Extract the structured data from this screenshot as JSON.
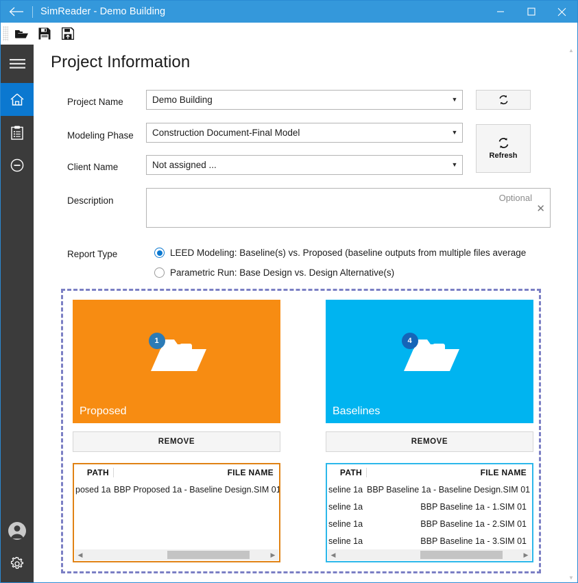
{
  "window": {
    "title": "SimReader - Demo Building",
    "back_icon": "back-arrow-icon",
    "minimize": "—",
    "maximize": "□",
    "close": "✕"
  },
  "toolbar": {
    "items": [
      {
        "name": "open-file-icon",
        "tooltip": "Open"
      },
      {
        "name": "save-icon",
        "tooltip": "Save"
      },
      {
        "name": "save-as-icon",
        "tooltip": "Save As"
      }
    ]
  },
  "sidebar": {
    "menu_icon": "hamburger-menu-icon",
    "items": [
      {
        "name": "home-icon",
        "active": true
      },
      {
        "name": "clipboard-icon",
        "active": false
      },
      {
        "name": "minus-circle-icon",
        "active": false
      }
    ],
    "bottom_items": [
      {
        "name": "user-account-icon"
      },
      {
        "name": "settings-gear-icon"
      }
    ],
    "active_color": "#0b78d0",
    "background": "#3b3b3b"
  },
  "main": {
    "page_title": "Project Information",
    "fields": {
      "project_name": {
        "label": "Project Name",
        "value": "Demo Building"
      },
      "modeling_phase": {
        "label": "Modeling Phase",
        "value": "Construction Document-Final Model"
      },
      "client_name": {
        "label": "Client Name",
        "value": "Not assigned ..."
      },
      "description": {
        "label": "Description",
        "value": "",
        "placeholder": "Optional",
        "clear_icon": "clear-x-icon"
      }
    },
    "refresh_small": {
      "icon": "refresh-icon"
    },
    "refresh_large": {
      "icon": "refresh-icon",
      "label": "Refresh"
    },
    "report_type": {
      "label": "Report Type",
      "options": [
        {
          "label": "LEED Modeling: Baseline(s) vs. Proposed (baseline outputs from multiple files average",
          "selected": true
        },
        {
          "label": "Parametric Run: Base Design vs. Design Alternative(s)",
          "selected": false
        }
      ]
    },
    "drop_zone": {
      "border_color": "#7b7fc4",
      "cards": [
        {
          "title": "Proposed",
          "badge": "1",
          "color": "#f78c12",
          "badge_color": "#2c7bb6",
          "remove_label": "REMOVE",
          "table": {
            "columns": [
              "PATH",
              "FILE NAME"
            ],
            "border_color": "#e08214",
            "rows": [
              {
                "path": "posed 1a",
                "file": "BBP Proposed 1a - Baseline Design.SIM 01"
              }
            ]
          }
        },
        {
          "title": "Baselines",
          "badge": "4",
          "color": "#00b4f0",
          "badge_color": "#1565b8",
          "remove_label": "REMOVE",
          "table": {
            "columns": [
              "PATH",
              "FILE NAME"
            ],
            "border_color": "#2bb7ea",
            "rows": [
              {
                "path": "seline 1a",
                "file": "BBP Baseline 1a - Baseline Design.SIM 01"
              },
              {
                "path": "seline 1a",
                "file": "BBP Baseline 1a - 1.SIM 01"
              },
              {
                "path": "seline 1a",
                "file": "BBP Baseline 1a - 2.SIM 01"
              },
              {
                "path": "seline 1a",
                "file": "BBP Baseline 1a - 3.SIM 01"
              }
            ]
          }
        }
      ]
    }
  },
  "scrollbar": {
    "up": "▲",
    "down": "▼",
    "left": "◀",
    "right": "▶"
  }
}
